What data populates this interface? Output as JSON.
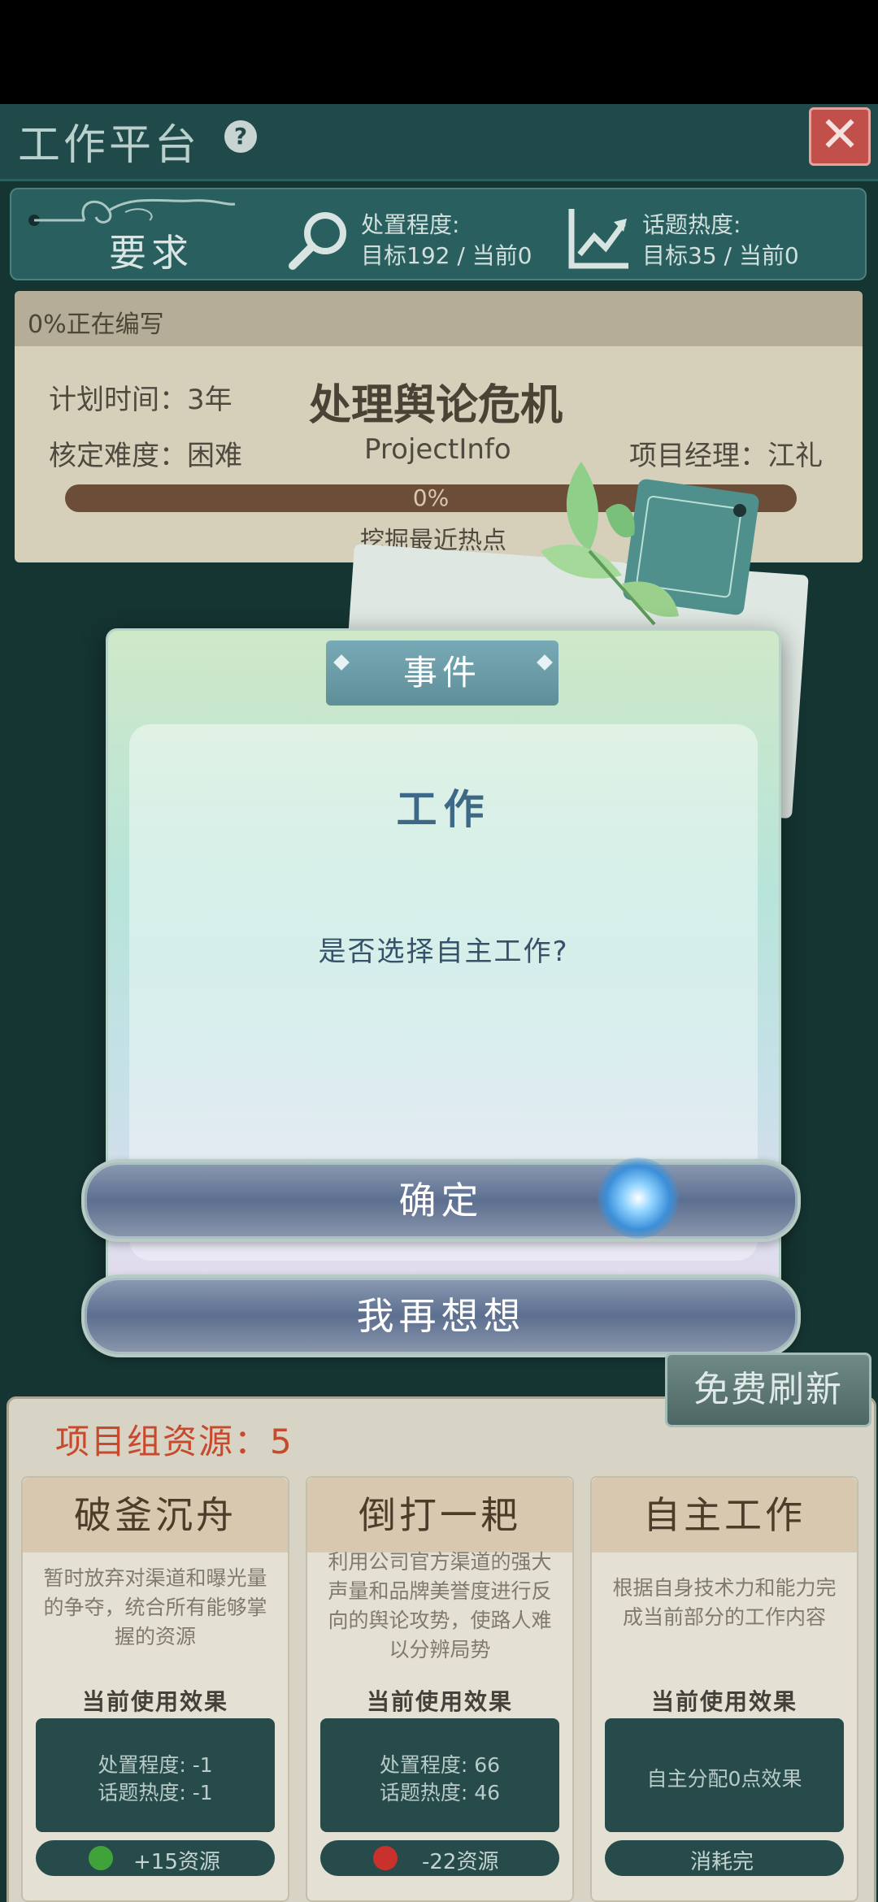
{
  "header": {
    "title": "工作平台",
    "help_label": "?",
    "close_label": "✕"
  },
  "requirements": {
    "label": "要求",
    "handling": {
      "title": "处置程度:",
      "value": "目标192 / 当前0"
    },
    "topic": {
      "title": "话题热度:",
      "value": "目标35 / 当前0"
    }
  },
  "project": {
    "status": "0%正在编写",
    "plan_time": "计划时间：3年",
    "name": "处理舆论危机",
    "difficulty": "核定难度：困难",
    "info": "ProjectInfo",
    "manager": "项目经理：江礼",
    "progress_label": "0%",
    "progress_value": 0,
    "subtask": "挖掘最近热点"
  },
  "dialog": {
    "tag": "事件",
    "title": "工作",
    "message": "是否选择自主工作?",
    "confirm_label": "确定",
    "cancel_label": "我再想想"
  },
  "refresh_label": "免费刷新",
  "resources": {
    "title": "项目组资源：5",
    "cards": [
      {
        "name": "破釜沉舟",
        "desc": "暂时放弃对渠道和曝光量的争夺，统合所有能够掌握的资源",
        "effect_label": "当前使用效果",
        "effect_lines": [
          "处置程度: -1",
          "话题热度: -1"
        ],
        "cost": "+15资源",
        "cost_color": "#3fa33a"
      },
      {
        "name": "倒打一耙",
        "desc": "利用公司官方渠道的强大声量和品牌美誉度进行反向的舆论攻势，使路人难以分辨局势",
        "effect_label": "当前使用效果",
        "effect_lines": [
          "处置程度: 66",
          "话题热度: 46"
        ],
        "cost": "-22资源",
        "cost_color": "#c8312c"
      },
      {
        "name": "自主工作",
        "desc": "根据自身技术力和能力完成当前部分的工作内容",
        "effect_label": "当前使用效果",
        "effect_lines": [
          "自主分配0点效果"
        ],
        "cost": "消耗完",
        "cost_color": ""
      }
    ]
  }
}
